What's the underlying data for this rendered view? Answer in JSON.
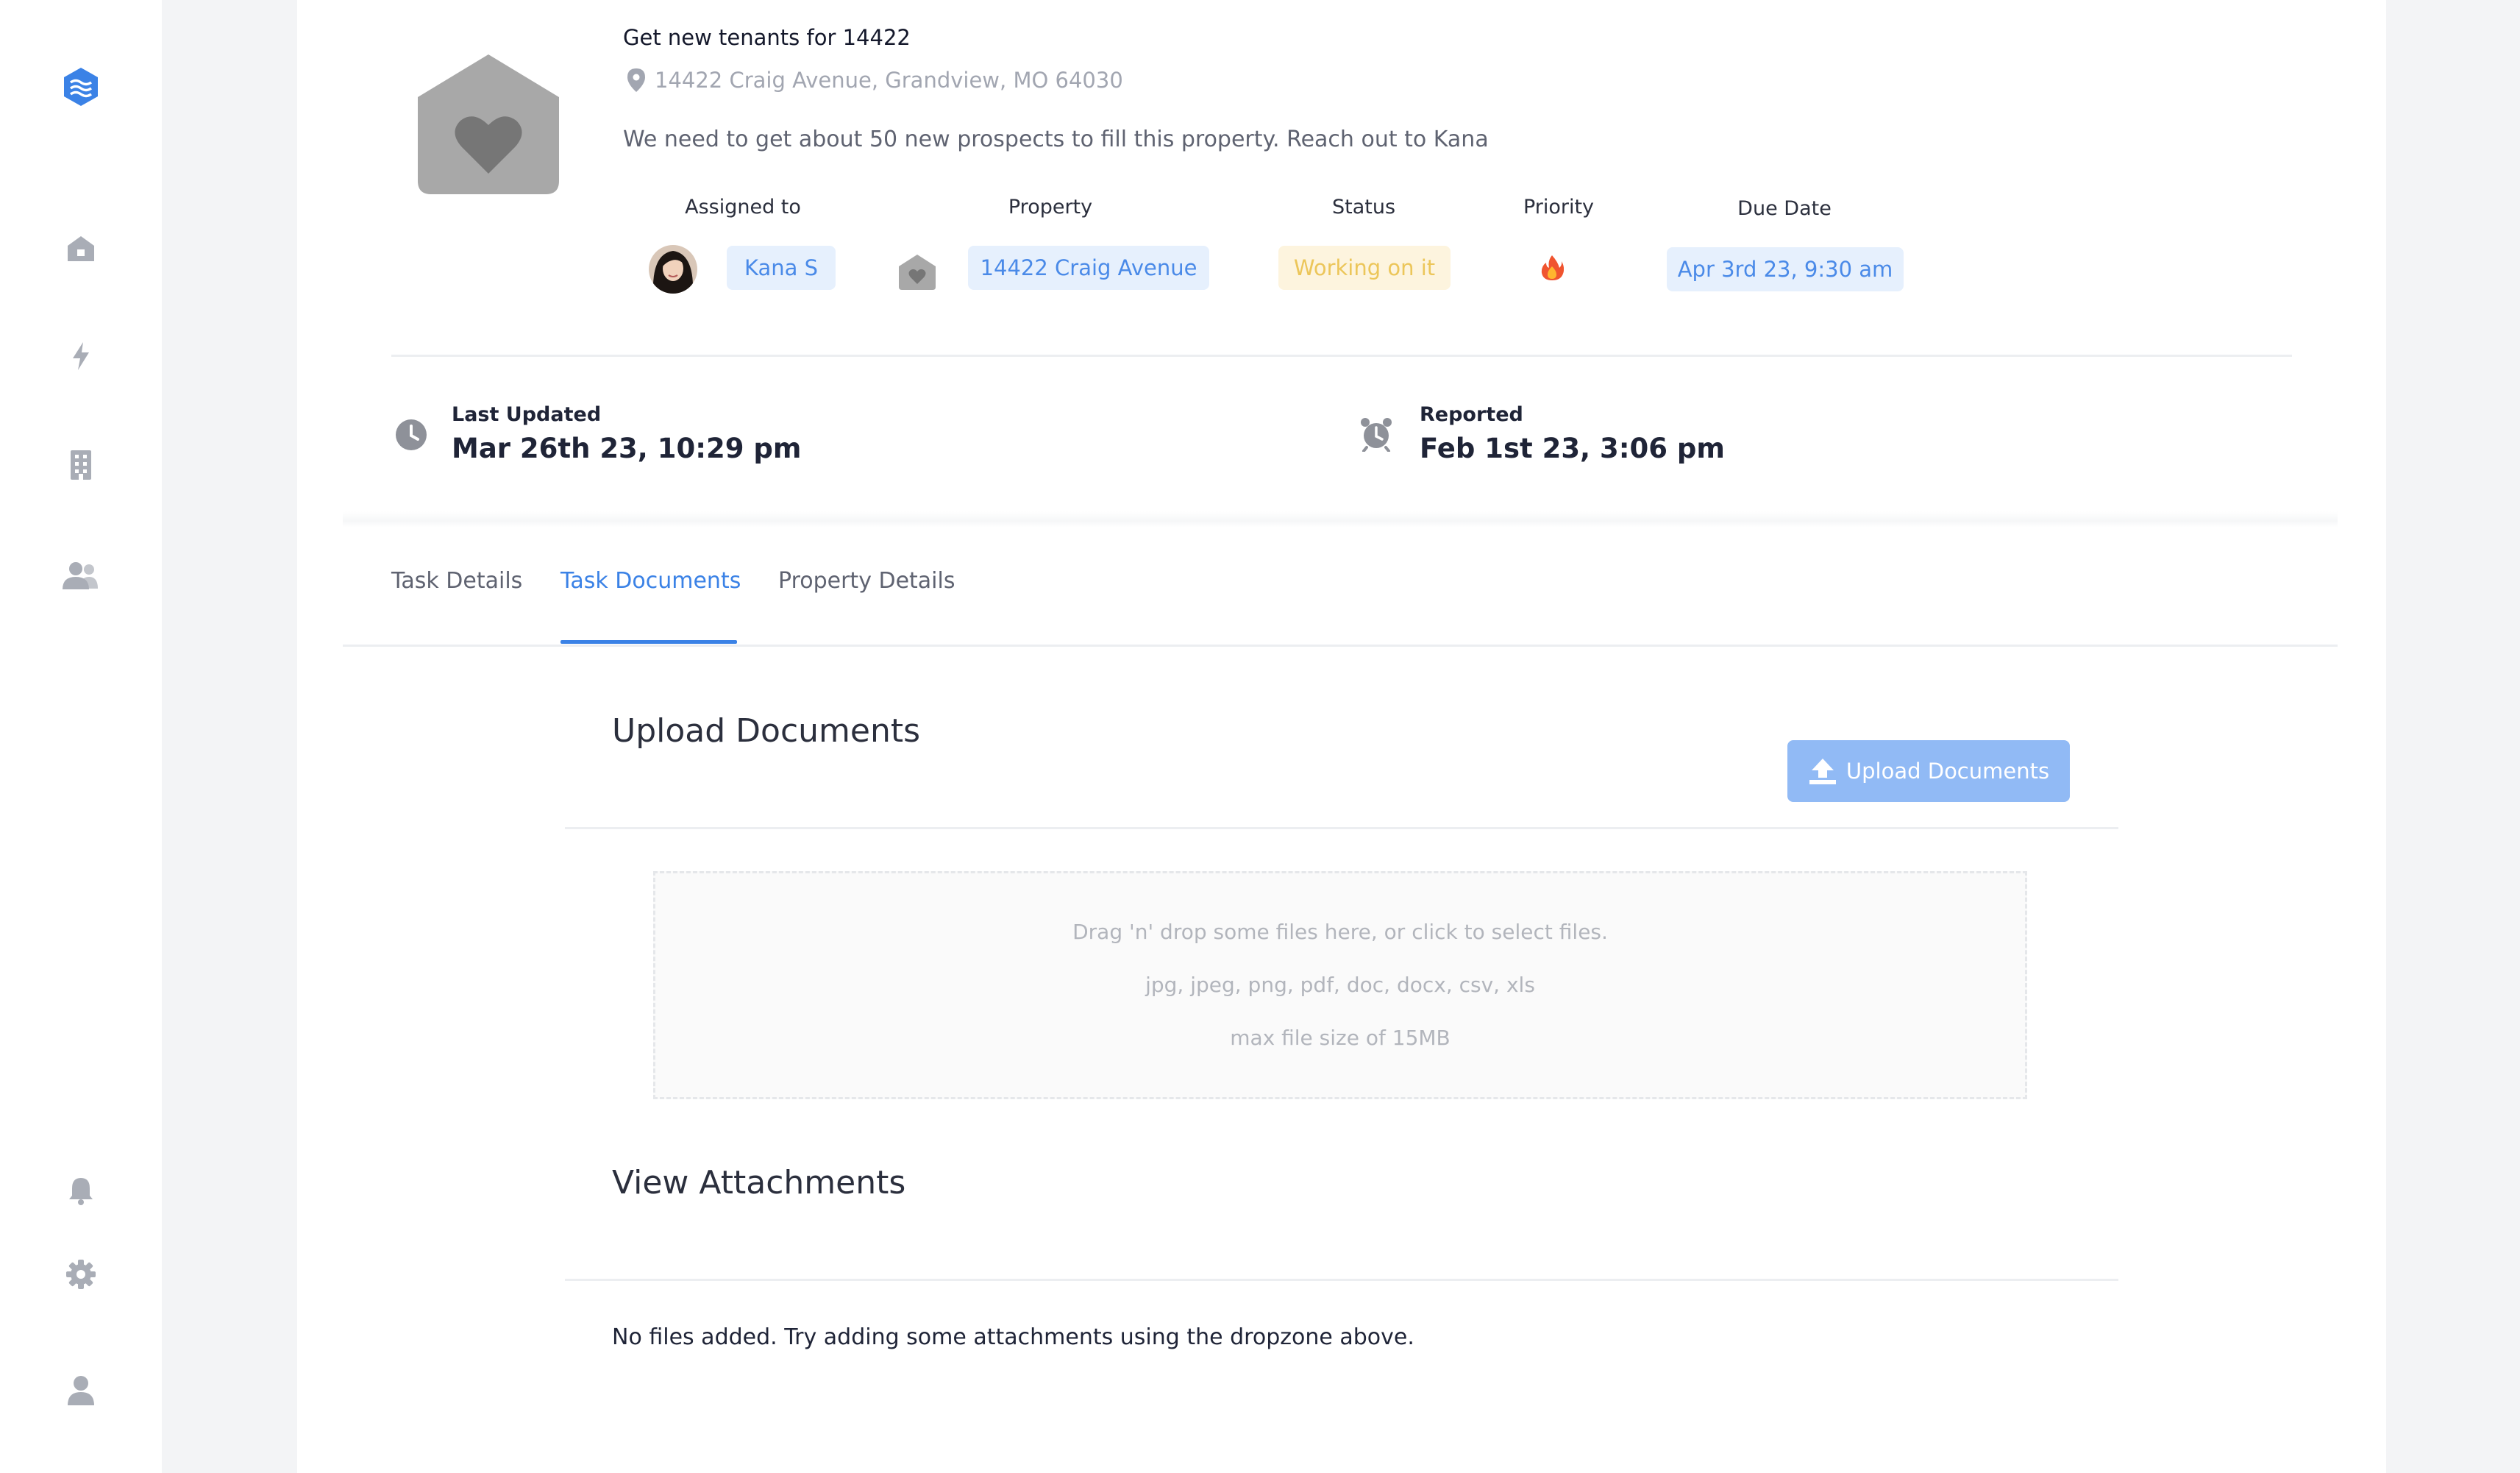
{
  "colors": {
    "accent": "#3b82e6",
    "pill_blue_bg": "#e6f0fd",
    "pill_yellow_bg": "#fdf4de",
    "button": "#91baf5"
  },
  "sidebar": {
    "logo_icon": "layers-logo-icon",
    "nav": [
      {
        "name": "home",
        "icon": "home-icon"
      },
      {
        "name": "activity",
        "icon": "lightning-icon"
      },
      {
        "name": "buildings",
        "icon": "building-icon"
      },
      {
        "name": "people",
        "icon": "users-icon"
      }
    ],
    "bottom": [
      {
        "name": "notifications",
        "icon": "bell-icon"
      },
      {
        "name": "settings",
        "icon": "gear-icon"
      },
      {
        "name": "profile",
        "icon": "user-icon"
      }
    ]
  },
  "task": {
    "title": "Get new tenants for 14422",
    "address": "14422 Craig Avenue, Grandview, MO 64030",
    "description": "We need to get about 50 new prospects to fill this property. Reach out to Kana"
  },
  "details": {
    "assigned_to": {
      "label": "Assigned to",
      "value": "Kana S"
    },
    "property": {
      "label": "Property",
      "value": "14422 Craig Avenue"
    },
    "status": {
      "label": "Status",
      "value": "Working on it"
    },
    "priority": {
      "label": "Priority",
      "icon": "fire-icon"
    },
    "due_date": {
      "label": "Due Date",
      "value": "Apr 3rd 23, 9:30 am"
    }
  },
  "meta": {
    "last_updated": {
      "label": "Last Updated",
      "value": "Mar 26th 23, 10:29 pm"
    },
    "reported": {
      "label": "Reported",
      "value": "Feb 1st 23, 3:06 pm"
    }
  },
  "tabs": [
    {
      "label": "Task Details",
      "active": false
    },
    {
      "label": "Task Documents",
      "active": true
    },
    {
      "label": "Property Details",
      "active": false
    }
  ],
  "upload": {
    "title": "Upload Documents",
    "button_label": "Upload Documents",
    "dropzone": {
      "line1": "Drag 'n' drop some files here, or click to select files.",
      "line2": "jpg, jpeg, png, pdf, doc, docx, csv, xls",
      "line3": "max file size of 15MB"
    }
  },
  "attachments": {
    "title": "View Attachments",
    "empty_message": "No files added. Try adding some attachments using the dropzone above."
  }
}
